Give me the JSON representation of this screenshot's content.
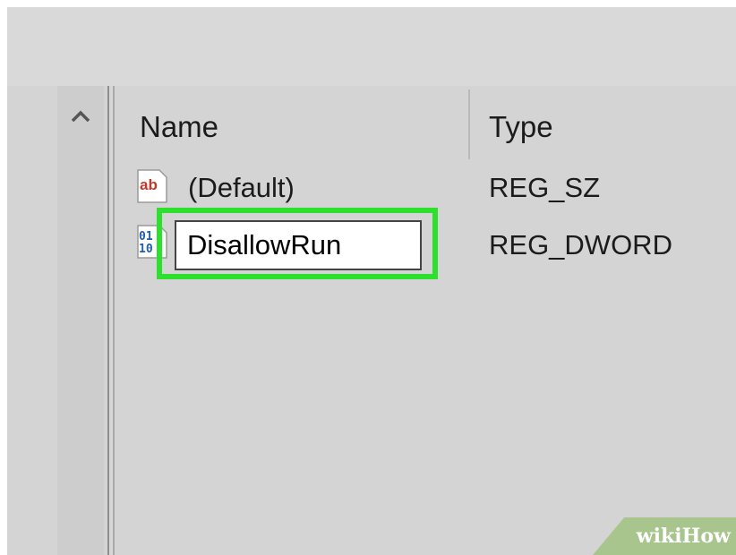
{
  "list": {
    "columns": {
      "name": "Name",
      "type": "Type"
    },
    "rows": [
      {
        "icon": "string-value-icon",
        "icon_text": "ab",
        "name": "(Default)",
        "type": "REG_SZ"
      },
      {
        "icon": "binary-value-icon",
        "name": "DisallowRun",
        "type": "REG_DWORD"
      }
    ],
    "rename_value": "DisallowRun"
  },
  "scrollbar": {
    "up_arrow": "^"
  },
  "watermark": {
    "wiki": "wiki",
    "how": "How"
  },
  "colors": {
    "highlight": "#2ee02e",
    "string_icon_red": "#c0392b",
    "binary_icon_blue": "#1e5fa8"
  }
}
